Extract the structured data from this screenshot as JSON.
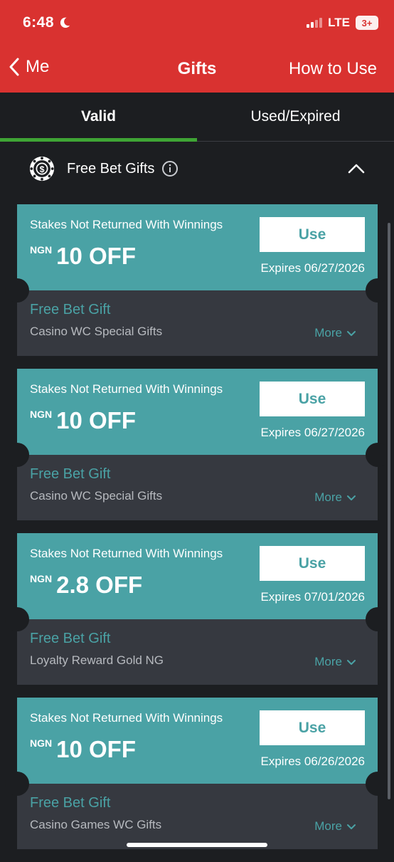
{
  "status_bar": {
    "time": "6:48",
    "network": "LTE",
    "battery": "3+"
  },
  "nav": {
    "back_label": "Me",
    "title": "Gifts",
    "right_label": "How to Use"
  },
  "tabs": [
    {
      "label": "Valid",
      "active": true
    },
    {
      "label": "Used/Expired",
      "active": false
    }
  ],
  "section": {
    "title": "Free Bet Gifts",
    "icon": "dollar-coin-icon"
  },
  "colors": {
    "header": "#d93230",
    "accent": "#4aa2a5",
    "tab_indicator": "#3fa535",
    "background": "#1c1e21",
    "card_bottom": "#363940"
  },
  "gifts": [
    {
      "description": "Stakes Not Returned With Winnings",
      "currency": "NGN",
      "value": "10 OFF",
      "button": "Use",
      "expires": "Expires 06/27/2026",
      "type": "Free Bet Gift",
      "name": "Casino WC Special Gifts",
      "more": "More"
    },
    {
      "description": "Stakes Not Returned With Winnings",
      "currency": "NGN",
      "value": "10 OFF",
      "button": "Use",
      "expires": "Expires 06/27/2026",
      "type": "Free Bet Gift",
      "name": "Casino WC Special Gifts",
      "more": "More"
    },
    {
      "description": "Stakes Not Returned With Winnings",
      "currency": "NGN",
      "value": "2.8 OFF",
      "button": "Use",
      "expires": "Expires 07/01/2026",
      "type": "Free Bet Gift",
      "name": "Loyalty Reward Gold NG",
      "more": "More"
    },
    {
      "description": "Stakes Not Returned With Winnings",
      "currency": "NGN",
      "value": "10 OFF",
      "button": "Use",
      "expires": "Expires 06/26/2026",
      "type": "Free Bet Gift",
      "name": "Casino Games WC Gifts",
      "more": "More"
    }
  ]
}
